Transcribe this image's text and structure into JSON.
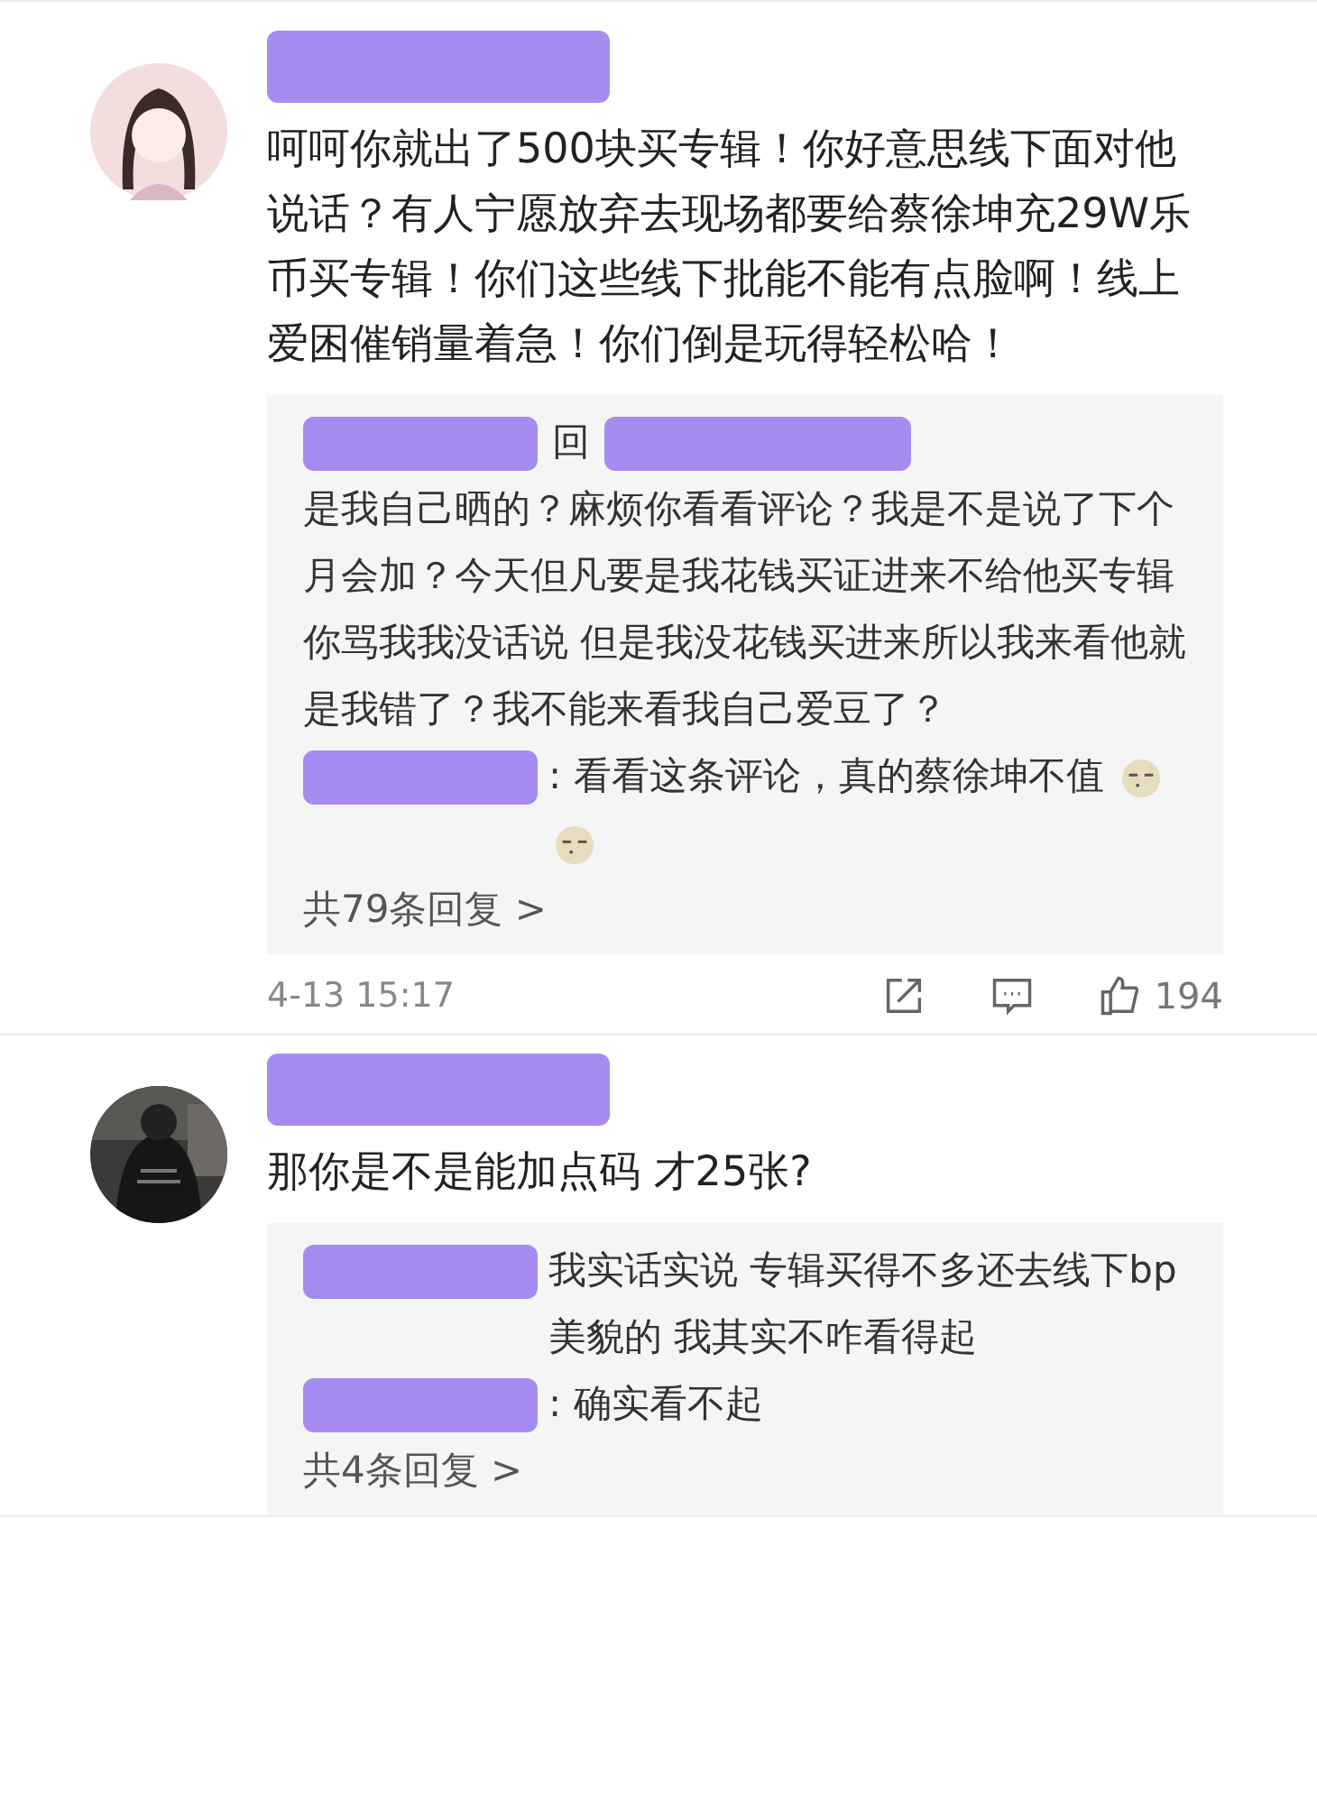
{
  "comments": [
    {
      "avatar": {
        "kind": "illustration"
      },
      "name_redacted": true,
      "text": "呵呵你就出了500块买专辑！你好意思线下面对他说话？有人宁愿放弃去现场都要给蔡徐坤充29W乐币买专辑！你们这些线下批能不能有点脸啊！线上爱困催销量着急！你们倒是玩得轻松哈！",
      "replies": [
        {
          "name_redacted": true,
          "reply_label": "回",
          "target_redacted": true,
          "text": "是我自己晒的？麻烦你看看评论？我是不是说了下个月会加？今天但凡要是我花钱买证进来不给他买专辑你骂我我没话说 但是我没花钱买进来所以我来看他就是我错了？我不能来看我自己爱豆了？"
        },
        {
          "name_redacted": true,
          "text": ": 看看这条评论，真的蔡徐坤不值",
          "emojis": [
            {
              "kind": "face"
            },
            {
              "kind": "face"
            }
          ]
        }
      ],
      "reply_count": "共79条回复 >",
      "time": "4-13 15:17",
      "likes": "194"
    },
    {
      "name_redacted": true,
      "text": "那你是不是能加点码 才25张?",
      "replies": [
        {
          "name_redacted": true,
          "text": "我实话实说 专辑买得不多还去线下bp美貌的 我其实不咋看得起"
        },
        {
          "name_redacted": true,
          "text": ": 确实看不起"
        }
      ],
      "reply_count": "共4条回复 >"
    }
  ]
}
